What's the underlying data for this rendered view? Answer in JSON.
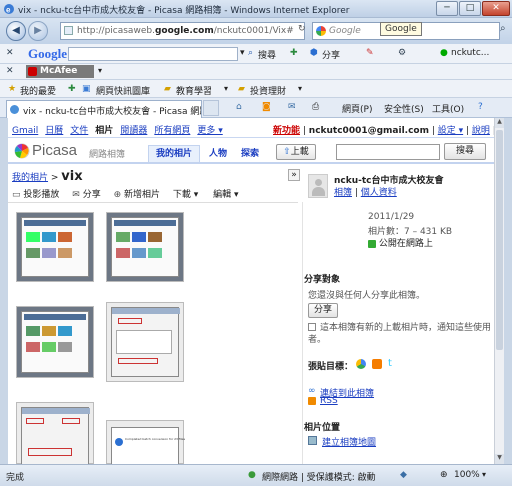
{
  "window": {
    "title": "vix - ncku-tc台中市成大校友會 - Picasa 網路相簿 - Windows Internet Explorer",
    "minimize": "─",
    "maximize": "□",
    "close": "✕"
  },
  "address_bar": {
    "url_prefix": "http://picasaweb.",
    "url_domain": "google.com",
    "url_rest": "/nckutc0001/Vix#",
    "search_placeholder": "Google",
    "tooltip": "Google"
  },
  "google_toolbar": {
    "logo": "Google",
    "search_label": "搜尋",
    "share_label": "分享",
    "account": "nckutc..."
  },
  "mcafee": {
    "label": "McAfee"
  },
  "favorites_bar": {
    "favorites": "我的最愛",
    "items": [
      "網頁快訊圖庫",
      "教育學習",
      "投資理財"
    ]
  },
  "tab": {
    "title": "vix - ncku-tc台中市成大校友會 - Picasa 網路相..."
  },
  "command_bar": {
    "page": "網頁(P)",
    "safety": "安全性(S)",
    "tools": "工具(O)"
  },
  "gnav": {
    "links": [
      "Gmail",
      "日曆",
      "文件",
      "相片",
      "閱讀器",
      "所有網頁",
      "更多 ▾"
    ],
    "new_feature": "新功能",
    "email": "nckutc0001@gmail.com",
    "settings": "設定 ▾",
    "help": "說明",
    "logout": "登出"
  },
  "picasa": {
    "logo": "Picasa",
    "logo_sub": "網路相簿",
    "tabs": [
      "我的相片",
      "人物",
      "探索"
    ],
    "upload": "上載",
    "search_button": "搜尋"
  },
  "breadcrumb": {
    "parent": "我的相片",
    "sep": " > ",
    "current": "vix"
  },
  "album_toolbar": {
    "slideshow": "投影播放",
    "share": "分享",
    "add_photos": "新增相片",
    "download": "下載 ▾",
    "edit": "編輯 ▾"
  },
  "sidebar": {
    "user_name": "ncku-tc台中市成大校友會",
    "album_link": "相簿",
    "profile_link": "個人資料",
    "date": "2011/1/29",
    "count": "相片數：7 – 431 KB",
    "visibility": "公開在網路上",
    "share_heading": "分享對象",
    "share_text": "您還沒與任何人分享此相簿。",
    "share_button": "分享",
    "notify_text": "這本相簿有新的上載相片時，通知這些使用者。",
    "post_label": "張貼目標：",
    "link_album": "連結到此相簿",
    "rss": "RSS",
    "location_heading": "相片位置",
    "create_map": "建立相簿地圖"
  },
  "thumb_dialog": {
    "text": "Completed batch conversion for 23 files"
  },
  "status_bar": {
    "left": "完成",
    "zone": "網際網路 | 受保護模式: 啟動",
    "zoom": "100%"
  },
  "colors": {
    "link": "#1a3dc1",
    "tab_active": "#e8f0fc",
    "new_feature": "#cc0000"
  }
}
